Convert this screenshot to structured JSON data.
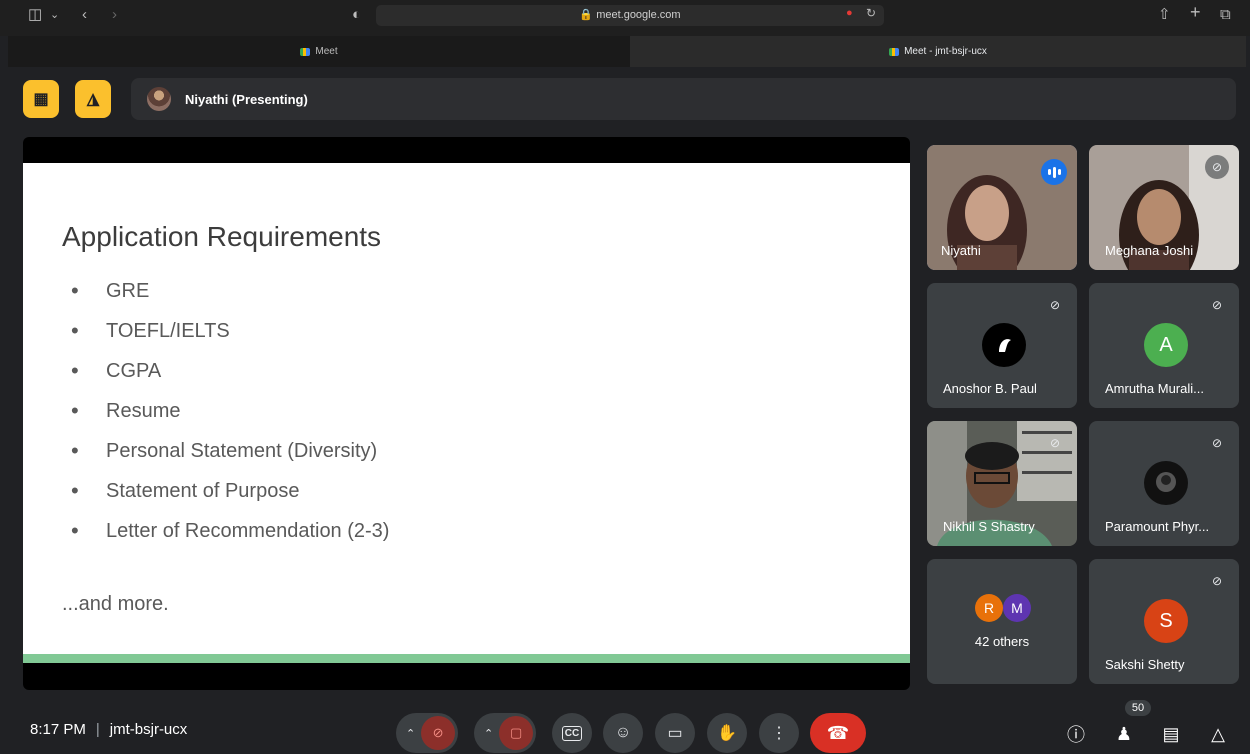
{
  "browser": {
    "url": "meet.google.com",
    "tabs": [
      {
        "label": "Meet"
      },
      {
        "label": "Meet - jmt-bsjr-ucx"
      }
    ]
  },
  "presenter": {
    "label": "Niyathi (Presenting)"
  },
  "slide": {
    "title": "Application Requirements",
    "bullets": [
      "GRE",
      "TOEFL/IELTS",
      "CGPA",
      "Resume",
      "Personal Statement (Diversity)",
      "Statement of Purpose",
      "Letter of Recommendation (2-3)"
    ],
    "more": "...and more."
  },
  "participants": [
    {
      "name": "Niyathi",
      "video": true,
      "speaking": true
    },
    {
      "name": "Meghana Joshi",
      "video": true,
      "muted": true
    },
    {
      "name": "Anoshor B. Paul",
      "muted": true,
      "avatar_color": "#000000"
    },
    {
      "name": "Amrutha Murali...",
      "muted": true,
      "avatar_letter": "A",
      "avatar_color": "#4caf50"
    },
    {
      "name": "Nikhil S Shastry",
      "video": true,
      "muted": true
    },
    {
      "name": "Paramount Phyr...",
      "muted": true,
      "avatar_color": "#000000"
    },
    {
      "name": "Sakshi Shetty",
      "muted": true,
      "avatar_letter": "S",
      "avatar_color": "#d84315"
    }
  ],
  "others": {
    "avatars": [
      {
        "letter": "R",
        "color": "#e8710a"
      },
      {
        "letter": "M",
        "color": "#5e35b1"
      }
    ],
    "label": "42 others"
  },
  "bottom": {
    "time": "8:17 PM",
    "separator": "|",
    "meeting_code": "jmt-bsjr-ucx",
    "participant_count": "50"
  },
  "colors": {
    "accent_yellow": "#fbc02d",
    "end_call": "#d93025",
    "slide_band": "#81c995",
    "active_speaker": "#8ab4f8"
  }
}
